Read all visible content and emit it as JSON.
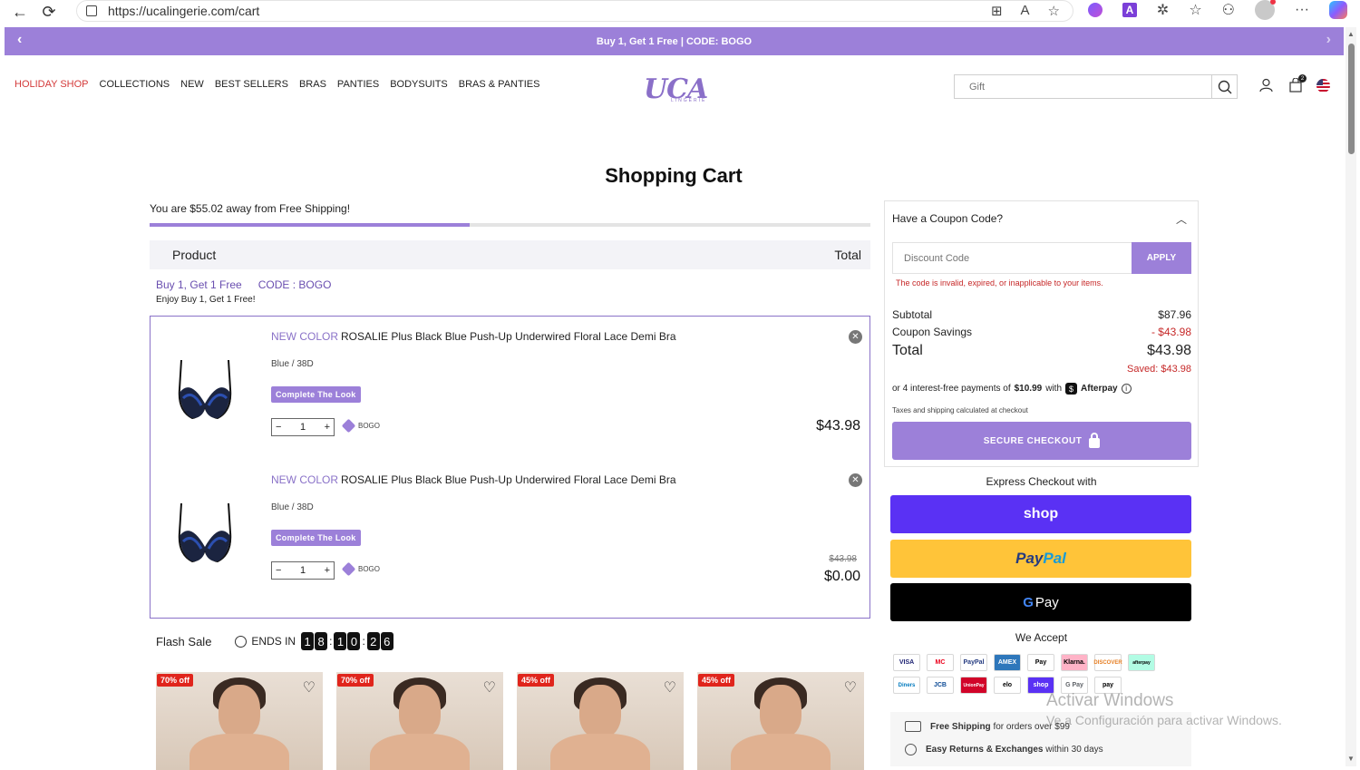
{
  "browser": {
    "url": "https://ucalingerie.com/cart"
  },
  "announcement": {
    "text": "Buy 1, Get 1 Free | CODE: BOGO"
  },
  "nav": {
    "items": [
      "HOLIDAY SHOP",
      "COLLECTIONS",
      "NEW",
      "BEST SELLERS",
      "BRAS",
      "PANTIES",
      "BODYSUITS",
      "BRAS & PANTIES"
    ]
  },
  "logo": {
    "text": "UCA",
    "sub": "LINGERIE"
  },
  "search": {
    "placeholder": "Gift"
  },
  "header": {
    "cart_count": "2"
  },
  "page": {
    "title": "Shopping Cart",
    "free_shipping_text": "You are $55.02 away from Free Shipping!",
    "free_shipping_progress": 0.444
  },
  "table": {
    "col_product": "Product",
    "col_total": "Total"
  },
  "promo": {
    "offer": "Buy 1, Get 1 Free",
    "code": "CODE : BOGO",
    "note": "Enjoy Buy 1, Get 1 Free!"
  },
  "cart_items": [
    {
      "new_label": "NEW COLOR",
      "name": "ROSALIE Plus Black Blue Push-Up Underwired Floral Lace Demi Bra",
      "variant": "Blue / 38D",
      "look_label": "Complete The Look",
      "qty": "1",
      "tag": "BOGO",
      "price": "$43.98",
      "original_price": ""
    },
    {
      "new_label": "NEW COLOR",
      "name": "ROSALIE Plus Black Blue Push-Up Underwired Floral Lace Demi Bra",
      "variant": "Blue / 38D",
      "look_label": "Complete The Look",
      "qty": "1",
      "tag": "BOGO",
      "price": "$0.00",
      "original_price": "$43.98"
    }
  ],
  "flash_sale": {
    "label": "Flash Sale",
    "ends_label": "ENDS IN",
    "digits": [
      "1",
      "8",
      "1",
      "0",
      "2",
      "6"
    ]
  },
  "products": [
    {
      "badge": "70% off"
    },
    {
      "badge": "70% off"
    },
    {
      "badge": "45% off"
    },
    {
      "badge": "45% off"
    }
  ],
  "coupon": {
    "heading": "Have a Coupon Code?",
    "placeholder": "Discount Code",
    "apply_label": "APPLY",
    "error": "The code is invalid, expired, or inapplicable to your items."
  },
  "summary": {
    "subtotal_label": "Subtotal",
    "subtotal": "$87.96",
    "savings_label": "Coupon Savings",
    "savings": "- $43.98",
    "total_label": "Total",
    "total": "$43.98",
    "saved_label": "Saved:",
    "saved": "$43.98",
    "afterpay_pre": "or 4 interest-free payments of",
    "afterpay_amount": "$10.99",
    "afterpay_with": "with",
    "afterpay_brand": "Afterpay",
    "taxes_note": "Taxes and shipping calculated at checkout",
    "checkout_label": "SECURE CHECKOUT"
  },
  "express": {
    "label": "Express Checkout with",
    "shop_label": "shop",
    "paypal_a": "Pay",
    "paypal_b": "Pal",
    "gpay_g": "G",
    "gpay_label": "Pay"
  },
  "accept": {
    "label": "We Accept",
    "icons": [
      "VISA",
      "MC",
      "PayPal",
      "AMEX",
      "Pay",
      "Klarna.",
      "DISCOVER",
      "afterpay",
      "Diners",
      "JCB",
      "UnionPay",
      "elo",
      "shop",
      "G Pay",
      "pay"
    ]
  },
  "perks": {
    "shipping_bold": "Free Shipping",
    "shipping_rest": "for orders over $99",
    "returns_bold": "Easy Returns & Exchanges",
    "returns_rest": "within 30 days"
  },
  "watermark": {
    "line1": "Activar Windows",
    "line2": "Ve a Configuración para activar Windows."
  },
  "colors": {
    "accent": "#9c80d9",
    "error": "#c62828",
    "shop_pay": "#5a31f4",
    "paypal": "#ffc439"
  }
}
